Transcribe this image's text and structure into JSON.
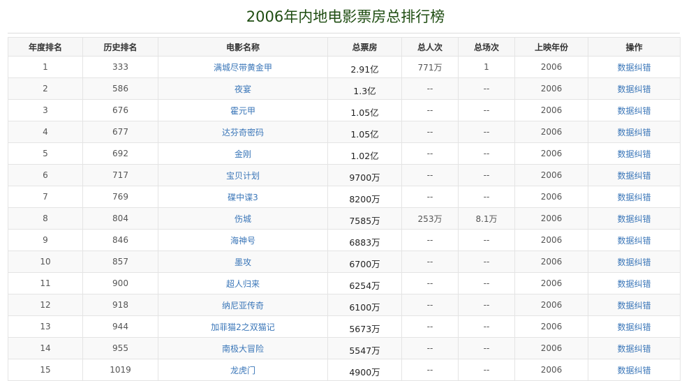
{
  "title": "2006年内地电影票房总排行榜",
  "headers": [
    "年度排名",
    "历史排名",
    "电影名称",
    "总票房",
    "总人次",
    "总场次",
    "上映年份",
    "操作"
  ],
  "rows": [
    [
      "1",
      "333",
      "满城尽带黄金甲",
      "2.91亿",
      "771万",
      "1",
      "2006",
      "数据纠错"
    ],
    [
      "2",
      "586",
      "夜宴",
      "1.3亿",
      "--",
      "--",
      "2006",
      "数据纠错"
    ],
    [
      "3",
      "676",
      "霍元甲",
      "1.05亿",
      "--",
      "--",
      "2006",
      "数据纠错"
    ],
    [
      "4",
      "677",
      "达芬奇密码",
      "1.05亿",
      "--",
      "--",
      "2006",
      "数据纠错"
    ],
    [
      "5",
      "692",
      "金刚",
      "1.02亿",
      "--",
      "--",
      "2006",
      "数据纠错"
    ],
    [
      "6",
      "717",
      "宝贝计划",
      "9700万",
      "--",
      "--",
      "2006",
      "数据纠错"
    ],
    [
      "7",
      "769",
      "碟中谍3",
      "8200万",
      "--",
      "--",
      "2006",
      "数据纠错"
    ],
    [
      "8",
      "804",
      "伤城",
      "7585万",
      "253万",
      "8.1万",
      "2006",
      "数据纠错"
    ],
    [
      "9",
      "846",
      "海神号",
      "6883万",
      "--",
      "--",
      "2006",
      "数据纠错"
    ],
    [
      "10",
      "857",
      "墨攻",
      "6700万",
      "--",
      "--",
      "2006",
      "数据纠错"
    ],
    [
      "11",
      "900",
      "超人归来",
      "6254万",
      "--",
      "--",
      "2006",
      "数据纠错"
    ],
    [
      "12",
      "918",
      "纳尼亚传奇",
      "6100万",
      "--",
      "--",
      "2006",
      "数据纠错"
    ],
    [
      "13",
      "944",
      "加菲猫2之双猫记",
      "5673万",
      "--",
      "--",
      "2006",
      "数据纠错"
    ],
    [
      "14",
      "955",
      "南极大冒险",
      "5547万",
      "--",
      "--",
      "2006",
      "数据纠错"
    ],
    [
      "15",
      "1019",
      "龙虎门",
      "4900万",
      "--",
      "--",
      "2006",
      "数据纠错"
    ]
  ]
}
